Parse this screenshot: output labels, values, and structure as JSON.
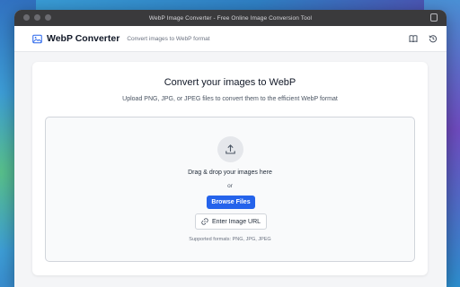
{
  "window": {
    "title": "WebP Image Converter - Free Online Image Conversion Tool"
  },
  "header": {
    "app_title": "WebP Converter",
    "subtitle": "Convert images to WebP format",
    "logo_icon": "image-icon",
    "actions": [
      "book-icon",
      "history-icon"
    ]
  },
  "main": {
    "heading": "Convert your images to WebP",
    "description": "Upload PNG, JPG, or JPEG files to convert them to the efficient WebP format",
    "dropzone": {
      "icon": "upload-icon",
      "drag_text": "Drag & drop your images here",
      "or_text": "or",
      "browse_label": "Browse Files",
      "url_label": "Enter Image URL",
      "url_icon": "link-icon",
      "formats_text": "Supported formats: PNG, JPG, JPEG"
    }
  },
  "colors": {
    "accent": "#2563eb",
    "titlebar": "#3a3a3c"
  }
}
